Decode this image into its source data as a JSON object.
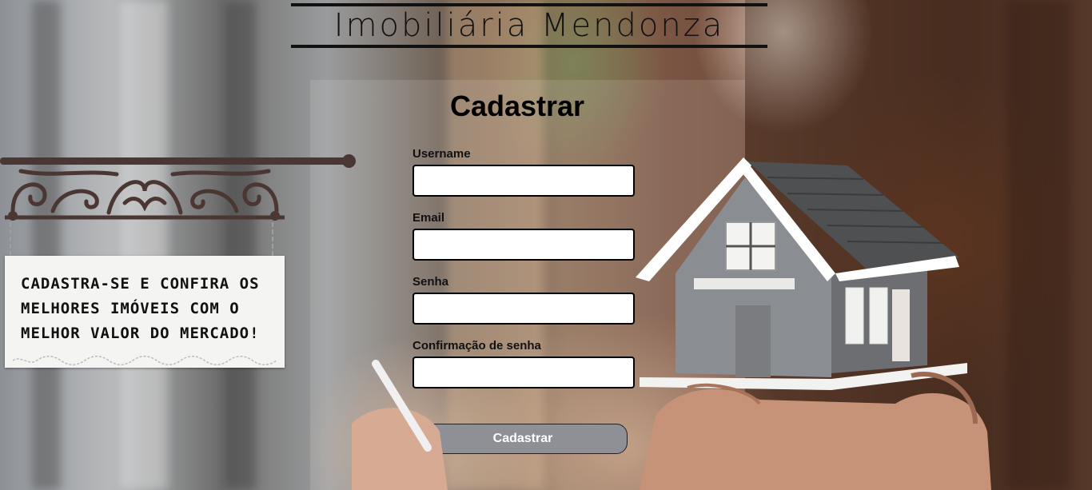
{
  "brand": {
    "title": "Imobiliária Mendonza"
  },
  "form": {
    "title": "Cadastrar",
    "fields": [
      {
        "label": "Username",
        "value": "",
        "placeholder": ""
      },
      {
        "label": "Email",
        "value": "",
        "placeholder": ""
      },
      {
        "label": "Senha",
        "value": "",
        "placeholder": ""
      },
      {
        "label": "Confirmação de senha",
        "value": "",
        "placeholder": ""
      }
    ],
    "submit_label": "Cadastrar"
  },
  "sign": {
    "lines": [
      "CADASTRA-SE E CONFIRA OS",
      "MELHORES IMÓVEIS COM O",
      "MELHOR VALOR DO MERCADO!"
    ]
  },
  "colors": {
    "button_bg": "#8e9096",
    "sign_metal": "#4a3632",
    "house_wall": "#8a8d92",
    "house_roof": "#4f5052"
  },
  "icons": {
    "house": "house-model-illustration",
    "sign": "hanging-sign-illustration"
  }
}
